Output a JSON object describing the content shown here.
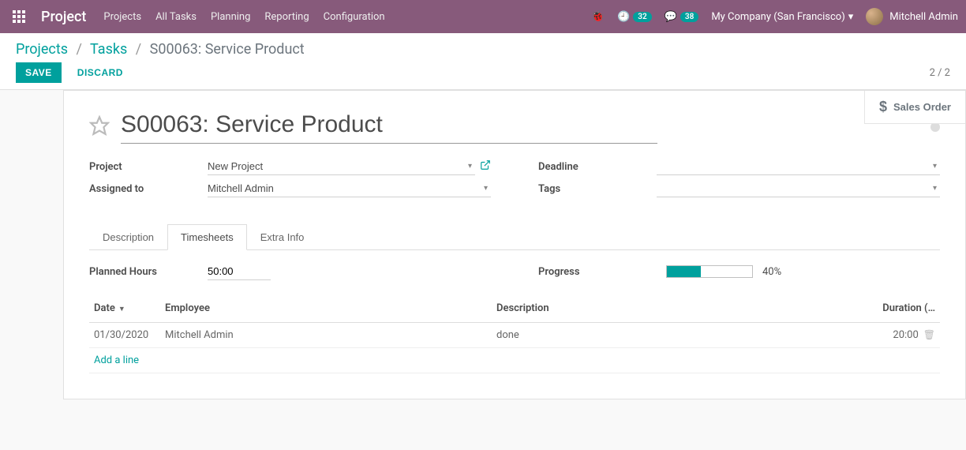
{
  "navbar": {
    "brand": "Project",
    "menu": [
      "Projects",
      "All Tasks",
      "Planning",
      "Reporting",
      "Configuration"
    ],
    "activities_count": "32",
    "messages_count": "38",
    "company": "My Company (San Francisco)",
    "user": "Mitchell Admin"
  },
  "breadcrumb": {
    "projects": "Projects",
    "tasks": "Tasks",
    "current": "S00063: Service Product"
  },
  "buttons": {
    "save": "SAVE",
    "discard": "DISCARD"
  },
  "pager": "2 / 2",
  "stat_button": "Sales Order",
  "form": {
    "title": "S00063: Service Product",
    "project_label": "Project",
    "project_value": "New Project",
    "assigned_label": "Assigned to",
    "assigned_value": "Mitchell Admin",
    "deadline_label": "Deadline",
    "deadline_value": "",
    "tags_label": "Tags",
    "tags_value": ""
  },
  "tabs": [
    "Description",
    "Timesheets",
    "Extra Info"
  ],
  "timesheet": {
    "planned_label": "Planned Hours",
    "planned_value": "50:00",
    "progress_label": "Progress",
    "progress_pct": 40,
    "progress_text": "40%",
    "columns": {
      "date": "Date",
      "employee": "Employee",
      "description": "Description",
      "duration": "Duration (…"
    },
    "rows": [
      {
        "date": "01/30/2020",
        "employee": "Mitchell Admin",
        "description": "done",
        "duration": "20:00"
      }
    ],
    "add_line": "Add a line"
  }
}
